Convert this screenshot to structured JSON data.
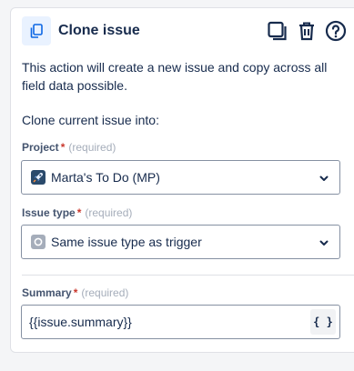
{
  "header": {
    "title": "Clone issue",
    "icons": [
      "clone-icon",
      "duplicate-icon",
      "delete-icon",
      "help-icon"
    ]
  },
  "description": "This action will create a new issue and copy across all field data possible.",
  "subheading": "Clone current issue into:",
  "fields": {
    "project": {
      "label": "Project",
      "required_star": "*",
      "required_text": "(required)",
      "value": "Marta's To Do (MP)",
      "icon": "project-rocket-icon"
    },
    "issue_type": {
      "label": "Issue type",
      "required_star": "*",
      "required_text": "(required)",
      "value": "Same issue type as trigger",
      "icon": "issue-type-icon"
    },
    "summary": {
      "label": "Summary",
      "required_star": "*",
      "required_text": "(required)",
      "value": "{{issue.summary}}",
      "smart_value_button": "{ }"
    }
  },
  "colors": {
    "accent": "#0c66e4",
    "required": "#c9372c",
    "text": "#172b4d",
    "muted": "#a5adba"
  }
}
